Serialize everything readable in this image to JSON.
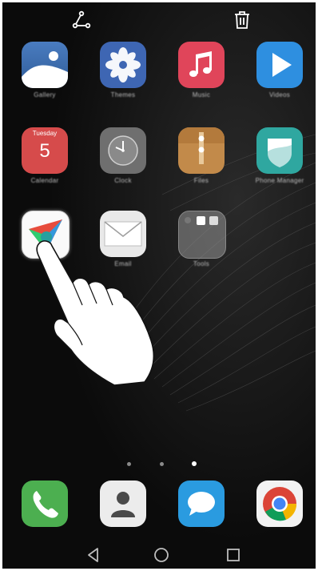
{
  "colors": {
    "gallery": "#3f6fa8",
    "themes": "#3e66b3",
    "music": "#e0455a",
    "videos": "#2e8fe0",
    "calendar": "#d64b4b",
    "clock": "#7b7b7b",
    "files": "#c28a4a",
    "phone_manager": "#2fa7a0",
    "phone": "#4caf50",
    "messaging": "#2a9be0"
  },
  "topbar": {
    "share_icon": "share-icon",
    "delete_icon": "trash-icon"
  },
  "apps": [
    {
      "name": "Gallery",
      "icon": "gallery-icon"
    },
    {
      "name": "Themes",
      "icon": "themes-icon"
    },
    {
      "name": "Music",
      "icon": "music-icon"
    },
    {
      "name": "Videos",
      "icon": "video-icon"
    },
    {
      "name": "Calendar",
      "icon": "calendar-icon",
      "day": "Tuesday",
      "date": "5"
    },
    {
      "name": "Clock",
      "icon": "clock-icon"
    },
    {
      "name": "Files",
      "icon": "files-icon"
    },
    {
      "name": "Phone Manager",
      "icon": "phone-manager-icon"
    },
    {
      "name": "",
      "icon": "paper-plane-app-icon"
    },
    {
      "name": "Email",
      "icon": "email-icon"
    },
    {
      "name": "Tools",
      "icon": "folder-icon"
    }
  ],
  "pager": {
    "pages": 3,
    "current": 3
  },
  "dock": [
    {
      "icon": "phone-icon"
    },
    {
      "icon": "contacts-icon"
    },
    {
      "icon": "messaging-icon"
    },
    {
      "icon": "chrome-icon"
    }
  ],
  "navbar": {
    "back": "back-triangle-icon",
    "home": "home-circle-icon",
    "recents": "recents-square-icon"
  }
}
